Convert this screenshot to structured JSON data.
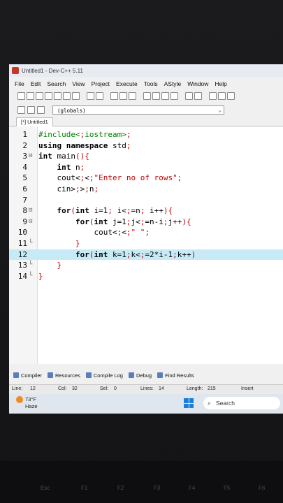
{
  "window": {
    "title": "Untitled1 - Dev-C++ 5.11"
  },
  "menu": [
    "File",
    "Edit",
    "Search",
    "View",
    "Project",
    "Execute",
    "Tools",
    "AStyle",
    "Window",
    "Help"
  ],
  "scope": {
    "value": "(globals)"
  },
  "tab": {
    "label": "[*] Untitled1"
  },
  "code": {
    "line_numbers": [
      "1",
      "2",
      "3",
      "4",
      "5",
      "6",
      "7",
      "8",
      "9",
      "10",
      "11",
      "12",
      "13",
      "14"
    ],
    "lines": [
      "#include<iostream>",
      "using namespace std;",
      "int main(){",
      "    int n;",
      "    cout<<\"Enter no of rows\";",
      "    cin>>n;",
      "",
      "    for(int i=1; i<=n; i++){",
      "        for(int j=1;j<=n-i;j++){",
      "            cout<<\" \";",
      "        }",
      "        for(int k=1;k<=2*i-1;k++)",
      "    }",
      "}"
    ]
  },
  "bottom_tabs": [
    "Compiler",
    "Resources",
    "Compile Log",
    "Debug",
    "Find Results"
  ],
  "status": {
    "line_label": "Line:",
    "line_value": "12",
    "col_label": "Col:",
    "col_value": "32",
    "sel_label": "Sel:",
    "sel_value": "0",
    "lines_label": "Lines:",
    "lines_value": "14",
    "length_label": "Length:",
    "length_value": "215",
    "mode": "Insert"
  },
  "taskbar": {
    "temp": "73°F",
    "weather": "Haze",
    "search": "Search"
  },
  "keyboard": [
    "Esc",
    "F1",
    "F2",
    "F3",
    "F4",
    "F5",
    "F6"
  ]
}
